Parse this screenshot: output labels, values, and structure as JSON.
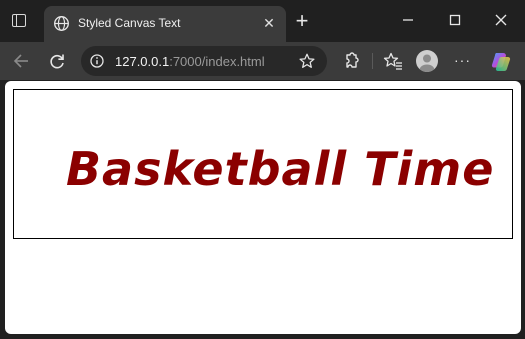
{
  "tab": {
    "title": "Styled Canvas Text",
    "close_label": "✕"
  },
  "toolbar": {
    "url_host": "127.0.0.1",
    "url_rest": ":7000/index.html"
  },
  "page": {
    "canvas_text": "Basketball Time",
    "canvas_text_color": "#8b0000"
  },
  "icons": [
    "window-menu-icon",
    "globe-icon",
    "close-icon",
    "new-tab-icon",
    "minimize-icon",
    "maximize-icon",
    "window-close-icon",
    "back-icon",
    "refresh-icon",
    "site-info-icon",
    "favorite-icon",
    "extensions-icon",
    "favorites-list-icon",
    "profile-avatar",
    "more-icon",
    "copilot-icon"
  ]
}
